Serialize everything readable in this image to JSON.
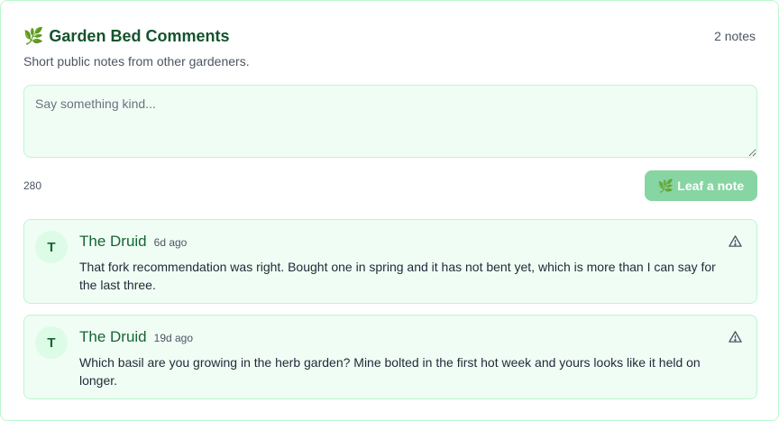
{
  "header": {
    "leaf_icon": "🌿",
    "title": "Garden Bed Comments",
    "count": "2 notes",
    "subtitle": "Short public notes from other gardeners."
  },
  "composer": {
    "placeholder": "Say something kind...",
    "value": "",
    "char_counter": "280",
    "submit_icon": "🌿",
    "submit_label": "Leaf a note"
  },
  "comments": [
    {
      "avatar": "T",
      "author": "The Druid",
      "time": "6d ago",
      "body": "That fork recommendation was right. Bought one in spring and it has not bent yet, which is more than I can say for the last three.",
      "report_icon": "warning-triangle-icon"
    },
    {
      "avatar": "T",
      "author": "The Druid",
      "time": "19d ago",
      "body": "Which basil are you growing in the herb garden? Mine bolted in the first hot week and yours looks like it held on longer.",
      "report_icon": "warning-triangle-icon"
    }
  ],
  "colors": {
    "accent": "#14532d",
    "border": "#bbf7d0",
    "surface": "#f0fdf4",
    "button": "#86d5a3"
  }
}
